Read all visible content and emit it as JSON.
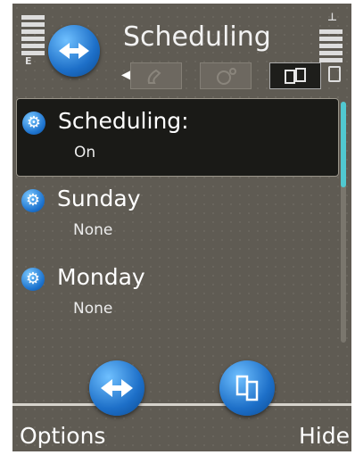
{
  "header": {
    "title": "Scheduling"
  },
  "status": {
    "signal_tag": "III",
    "battery_tag": "⇩"
  },
  "tabs": [
    {
      "icon": "phone-icon",
      "active": false
    },
    {
      "icon": "camera-icon",
      "active": false
    },
    {
      "icon": "sync-icon",
      "active": true
    }
  ],
  "list": {
    "items": [
      {
        "label": "Scheduling:",
        "value": "On",
        "selected": true
      },
      {
        "label": "Sunday",
        "value": "None",
        "selected": false
      },
      {
        "label": "Monday",
        "value": "None",
        "selected": false
      }
    ]
  },
  "softkeys": {
    "left": "Options",
    "right": "Hide"
  },
  "colors": {
    "accent": "#1d6fc8",
    "scroll_thumb": "#50c8d0",
    "background": "#5f5b53"
  }
}
